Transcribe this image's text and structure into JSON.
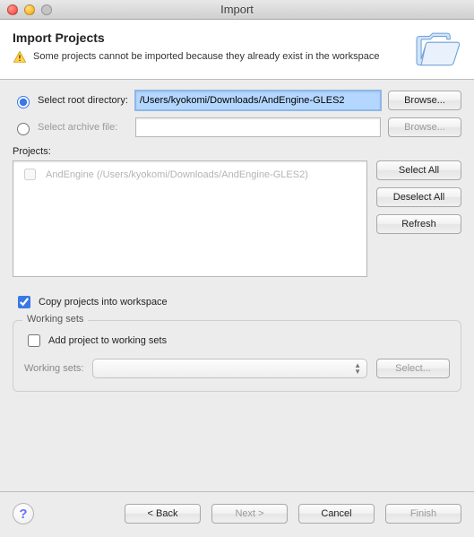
{
  "window": {
    "title": "Import"
  },
  "header": {
    "title": "Import Projects",
    "message": "Some projects cannot be imported because they already exist in the workspace"
  },
  "source": {
    "root_radio_label": "Select root directory:",
    "root_value": "/Users/kyokomi/Downloads/AndEngine-GLES2",
    "root_browse": "Browse...",
    "archive_radio_label": "Select archive file:",
    "archive_value": "",
    "archive_browse": "Browse..."
  },
  "projects": {
    "label": "Projects:",
    "item_label": "AndEngine (/Users/kyokomi/Downloads/AndEngine-GLES2)",
    "select_all": "Select All",
    "deselect_all": "Deselect All",
    "refresh": "Refresh"
  },
  "options": {
    "copy_label": "Copy projects into workspace"
  },
  "working_sets": {
    "legend": "Working sets",
    "add_label": "Add project to working sets",
    "ws_label": "Working sets:",
    "select": "Select..."
  },
  "footer": {
    "back": "< Back",
    "next": "Next >",
    "cancel": "Cancel",
    "finish": "Finish"
  }
}
